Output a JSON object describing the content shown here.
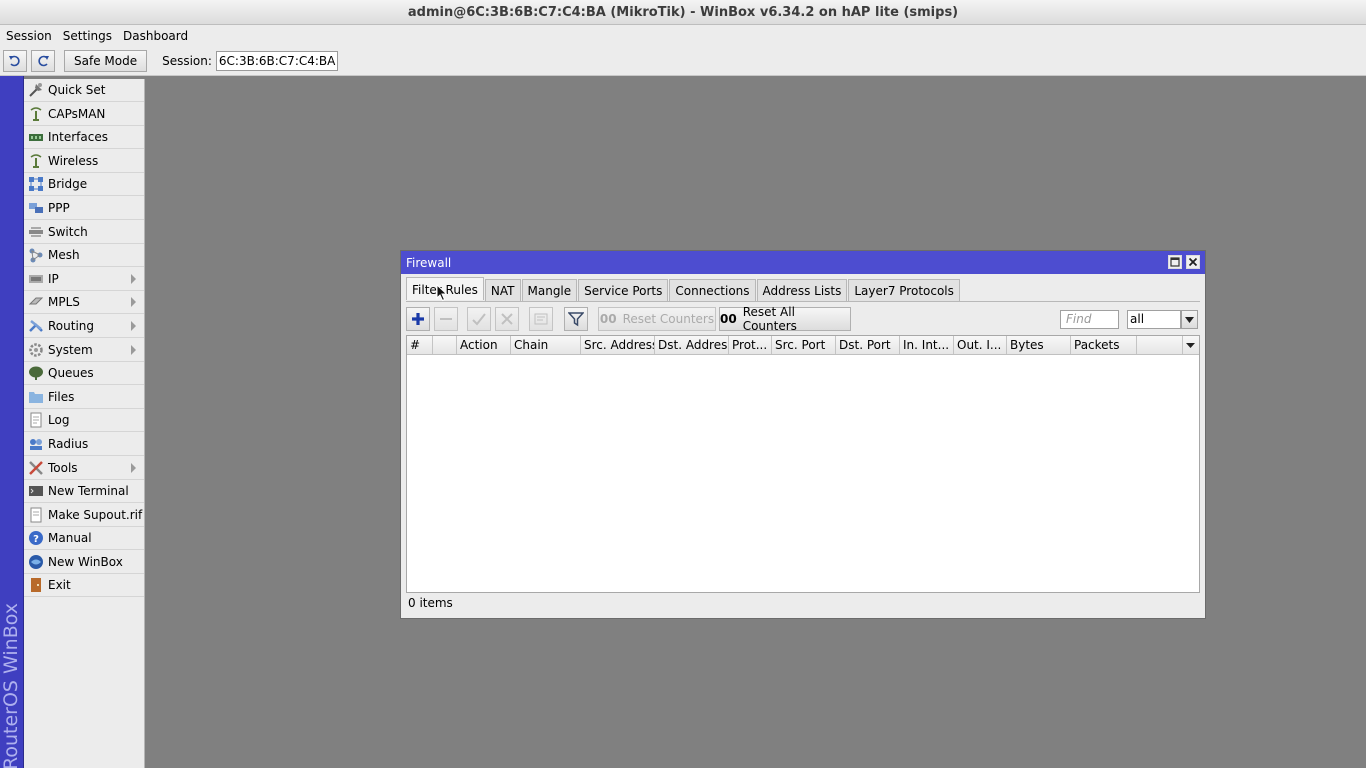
{
  "window": {
    "title": "admin@6C:3B:6B:C7:C4:BA (MikroTik) - WinBox v6.34.2 on hAP lite (smips)"
  },
  "menubar": {
    "items": [
      "Session",
      "Settings",
      "Dashboard"
    ]
  },
  "toolbar": {
    "safe_mode": "Safe Mode",
    "session_label": "Session:",
    "session_value": "6C:3B:6B:C7:C4:BA"
  },
  "brand": {
    "vertical_text": "RouterOS WinBox"
  },
  "sidebar": {
    "items": [
      {
        "label": "Quick Set",
        "icon": "quick-set-icon",
        "submenu": false
      },
      {
        "label": "CAPsMAN",
        "icon": "capsman-icon",
        "submenu": false
      },
      {
        "label": "Interfaces",
        "icon": "interfaces-icon",
        "submenu": false
      },
      {
        "label": "Wireless",
        "icon": "wireless-icon",
        "submenu": false
      },
      {
        "label": "Bridge",
        "icon": "bridge-icon",
        "submenu": false
      },
      {
        "label": "PPP",
        "icon": "ppp-icon",
        "submenu": false
      },
      {
        "label": "Switch",
        "icon": "switch-icon",
        "submenu": false
      },
      {
        "label": "Mesh",
        "icon": "mesh-icon",
        "submenu": false
      },
      {
        "label": "IP",
        "icon": "ip-icon",
        "submenu": true
      },
      {
        "label": "MPLS",
        "icon": "mpls-icon",
        "submenu": true
      },
      {
        "label": "Routing",
        "icon": "routing-icon",
        "submenu": true
      },
      {
        "label": "System",
        "icon": "system-icon",
        "submenu": true
      },
      {
        "label": "Queues",
        "icon": "queues-icon",
        "submenu": false
      },
      {
        "label": "Files",
        "icon": "files-icon",
        "submenu": false
      },
      {
        "label": "Log",
        "icon": "log-icon",
        "submenu": false
      },
      {
        "label": "Radius",
        "icon": "radius-icon",
        "submenu": false
      },
      {
        "label": "Tools",
        "icon": "tools-icon",
        "submenu": true
      },
      {
        "label": "New Terminal",
        "icon": "terminal-icon",
        "submenu": false
      },
      {
        "label": "Make Supout.rif",
        "icon": "supout-icon",
        "submenu": false
      },
      {
        "label": "Manual",
        "icon": "manual-icon",
        "submenu": false
      },
      {
        "label": "New WinBox",
        "icon": "new-winbox-icon",
        "submenu": false
      },
      {
        "label": "Exit",
        "icon": "exit-icon",
        "submenu": false
      }
    ]
  },
  "firewall": {
    "title": "Firewall",
    "tabs": [
      "Filter Rules",
      "NAT",
      "Mangle",
      "Service Ports",
      "Connections",
      "Address Lists",
      "Layer7 Protocols"
    ],
    "active_tab": "Filter Rules",
    "toolbar": {
      "reset_counters": "Reset Counters",
      "reset_all_counters": "Reset All Counters",
      "counter_prefix": "00"
    },
    "find_placeholder": "Find",
    "filter_value": "all",
    "columns": [
      "#",
      "",
      "Action",
      "Chain",
      "Src. Address",
      "Dst. Address",
      "Prot...",
      "Src. Port",
      "Dst. Port",
      "In. Int...",
      "Out. I...",
      "Bytes",
      "Packets"
    ],
    "status": "0 items"
  },
  "colors": {
    "accent": "#4d4dd0",
    "strip": "#3f3fc0",
    "desktop": "#808080",
    "panel": "#ececec"
  }
}
